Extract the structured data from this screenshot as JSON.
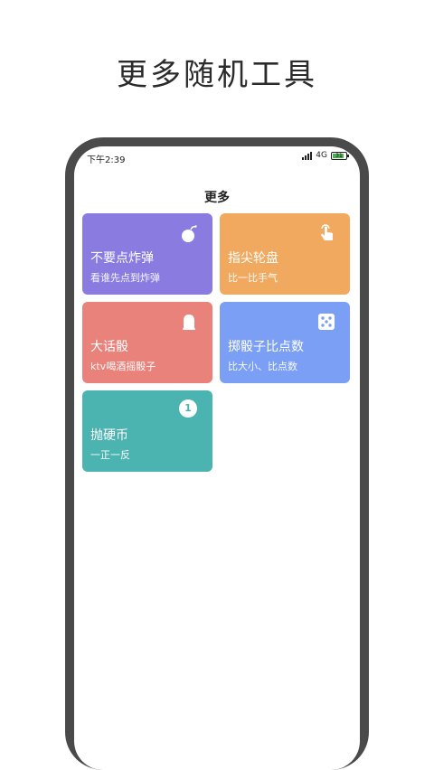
{
  "headline": "更多随机工具",
  "status_bar": {
    "time": "下午2:39",
    "network": "4G",
    "battery": "31"
  },
  "page_title": "更多",
  "cards": [
    {
      "title": "不要点炸弹",
      "subtitle": "看谁先点到炸弹",
      "color": "#8a7be0",
      "icon": "bomb-icon"
    },
    {
      "title": "指尖轮盘",
      "subtitle": "比一比手气",
      "color": "#f0a95f",
      "icon": "finger-tap-icon"
    },
    {
      "title": "大话骰",
      "subtitle": "ktv喝酒摇骰子",
      "color": "#e8827a",
      "icon": "dice-cup-icon"
    },
    {
      "title": "掷骰子比点数",
      "subtitle": "比大小、比点数",
      "color": "#7b9ff5",
      "icon": "dice-icon"
    },
    {
      "title": "抛硬币",
      "subtitle": "一正一反",
      "color": "#4bb3b0",
      "icon": "coin-icon",
      "icon_text": "1"
    }
  ]
}
